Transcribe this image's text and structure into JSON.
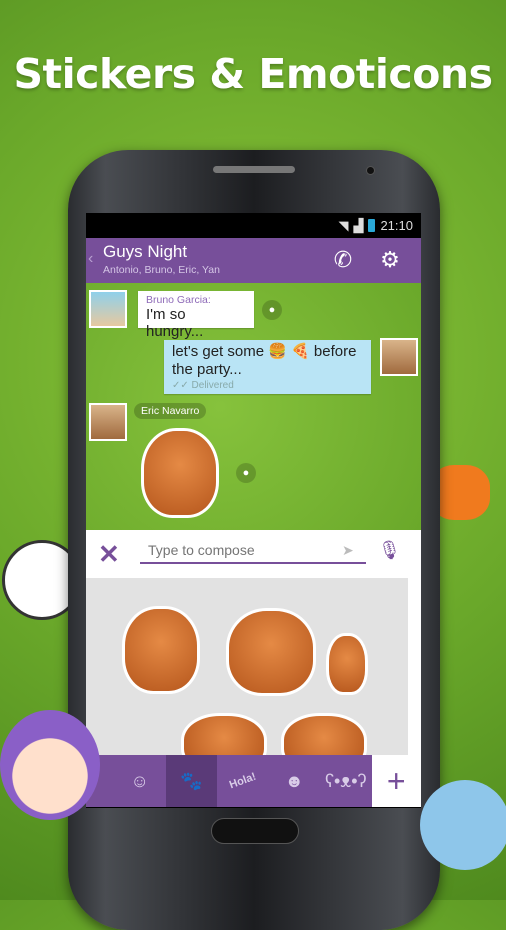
{
  "headline": "Stickers & Emoticons",
  "status": {
    "time": "21:10",
    "icons": [
      "wifi-icon",
      "signal-icon",
      "battery-icon"
    ]
  },
  "header": {
    "title": "Guys Night",
    "subtitle": "Antonio, Bruno, Eric, Yan",
    "icons": [
      "back-chevron-icon",
      "call-icon",
      "settings-gear-icon"
    ]
  },
  "messages": [
    {
      "sender": "Bruno Garcia:",
      "text": "I'm so hungry...",
      "direction": "incoming"
    },
    {
      "text": "let's get some 🍔 🍕 before the party...",
      "status": "Delivered",
      "direction": "outgoing"
    },
    {
      "sender": "Eric Navarro",
      "type": "sticker",
      "direction": "incoming"
    }
  ],
  "compose": {
    "placeholder": "Type to compose",
    "icons": [
      "close-x-icon",
      "send-icon",
      "microphone-icon"
    ]
  },
  "sticker_tabs": [
    {
      "icon": "face-sticker-icon"
    },
    {
      "icon": "red-panda-sticker-icon",
      "active": true
    },
    {
      "label": "Hola!"
    },
    {
      "icon": "girl-sticker-icon"
    },
    {
      "icon": "koala-sticker-icon"
    }
  ],
  "add_label": "+",
  "colors": {
    "accent": "#774f9a",
    "outgoing_bubble": "#b9e4f5",
    "background": "#6aa82a"
  }
}
